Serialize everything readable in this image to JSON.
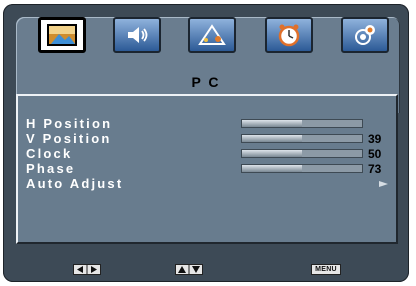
{
  "osd": {
    "tabs": [
      {
        "icon": "picture-icon",
        "active": true
      },
      {
        "icon": "speaker-icon",
        "active": false
      },
      {
        "icon": "setup-icon",
        "active": false
      },
      {
        "icon": "clock-icon",
        "active": false
      },
      {
        "icon": "options-icon",
        "active": false
      }
    ],
    "title": "P C",
    "items": [
      {
        "label": "H Position",
        "value": "",
        "level": 0.5
      },
      {
        "label": "V Position",
        "value": "39",
        "level": 0.5
      },
      {
        "label": "Clock",
        "value": "50",
        "level": 0.5
      },
      {
        "label": "Phase",
        "value": "73",
        "level": 0.5
      },
      {
        "label": "Auto Adjust",
        "value": "",
        "action": "arrow-right-icon"
      }
    ],
    "footer": {
      "left_right_icons": [
        "arrow-left-icon",
        "arrow-right-icon"
      ],
      "up_down_icons": [
        "arrow-up-icon",
        "arrow-down-icon"
      ],
      "menu_label": "MENU"
    },
    "colors": {
      "frame": "#3d4a56",
      "panel": "#687c8e",
      "tab_blue": "#2c5a96",
      "text_label": "#ffffff",
      "text_value": "#000000"
    }
  }
}
